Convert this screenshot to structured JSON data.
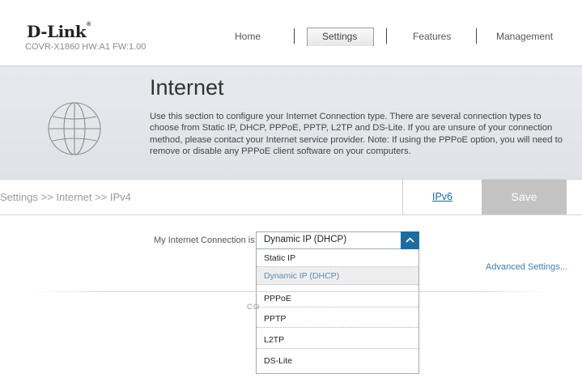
{
  "header": {
    "brand": "D-Link",
    "model": "COVR-X1860 HW:A1 FW:1.00",
    "nav": [
      "Home",
      "Settings",
      "Features",
      "Management"
    ],
    "active_nav": "Settings"
  },
  "banner": {
    "title": "Internet",
    "description": "Use this section to configure your Internet Connection type. There are several connection types to choose from Static IP, DHCP, PPPoE, PPTP, L2TP and DS-Lite. If you are unsure of your connection method, please contact your Internet service provider. Note: If using the PPPoE option, you will need to remove or disable any PPPoE client software on your computers.",
    "icon": "globe-icon"
  },
  "toolbar": {
    "breadcrumb": "Settings >> Internet >> IPv4",
    "ipv6_tab": "IPv6",
    "save": "Save"
  },
  "connection": {
    "label": "My Internet Connection is:",
    "selected": "Dynamic IP (DHCP)",
    "options": [
      "Static IP",
      "Dynamic IP (DHCP)",
      "PPPoE",
      "PPTP",
      "L2TP",
      "DS-Lite"
    ]
  },
  "advanced_link": "Advanced Settings...",
  "partial_text": "CO",
  "colors": {
    "accent": "#1e6c9f",
    "link": "#3f7eae",
    "save_bg": "#c3c3c3",
    "banner_bg": "#e3e7eb"
  }
}
